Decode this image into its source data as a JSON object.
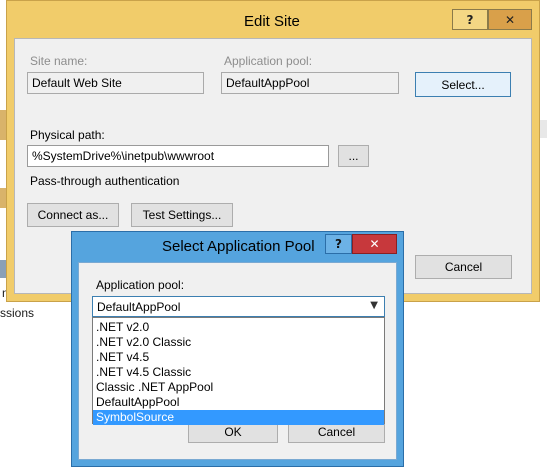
{
  "edit_site": {
    "title": "Edit Site",
    "help_btn": "?",
    "close_btn": "✕",
    "site_name_label": "Site name:",
    "site_name_value": "Default Web Site",
    "app_pool_label": "Application pool:",
    "app_pool_value": "DefaultAppPool",
    "select_btn": "Select...",
    "physical_path_label": "Physical path:",
    "physical_path_value": "%SystemDrive%\\inetpub\\wwwroot",
    "browse_btn": "...",
    "pass_through_label": "Pass-through authentication",
    "connect_as_btn": "Connect as...",
    "test_settings_btn": "Test Settings...",
    "cancel_btn": "Cancel"
  },
  "select_pool": {
    "title": "Select Application Pool",
    "help_btn": "?",
    "close_btn": "✕",
    "pool_label": "Application pool:",
    "combo_value": "DefaultAppPool",
    "options": [
      ".NET v2.0",
      ".NET v2.0 Classic",
      ".NET v4.5",
      ".NET v4.5 Classic",
      "Classic .NET AppPool",
      "DefaultAppPool",
      "SymbolSource"
    ],
    "highlighted_option": "SymbolSource",
    "ok_btn": "OK",
    "cancel_btn": "Cancel"
  },
  "background": {
    "left_text_1": "nager",
    "left_text_2": "ssions"
  },
  "colors": {
    "edit_frame": "#f1cc6a",
    "dialog_frame": "#55a4de",
    "selection": "#3399ff",
    "close_red": "#c7383c"
  }
}
